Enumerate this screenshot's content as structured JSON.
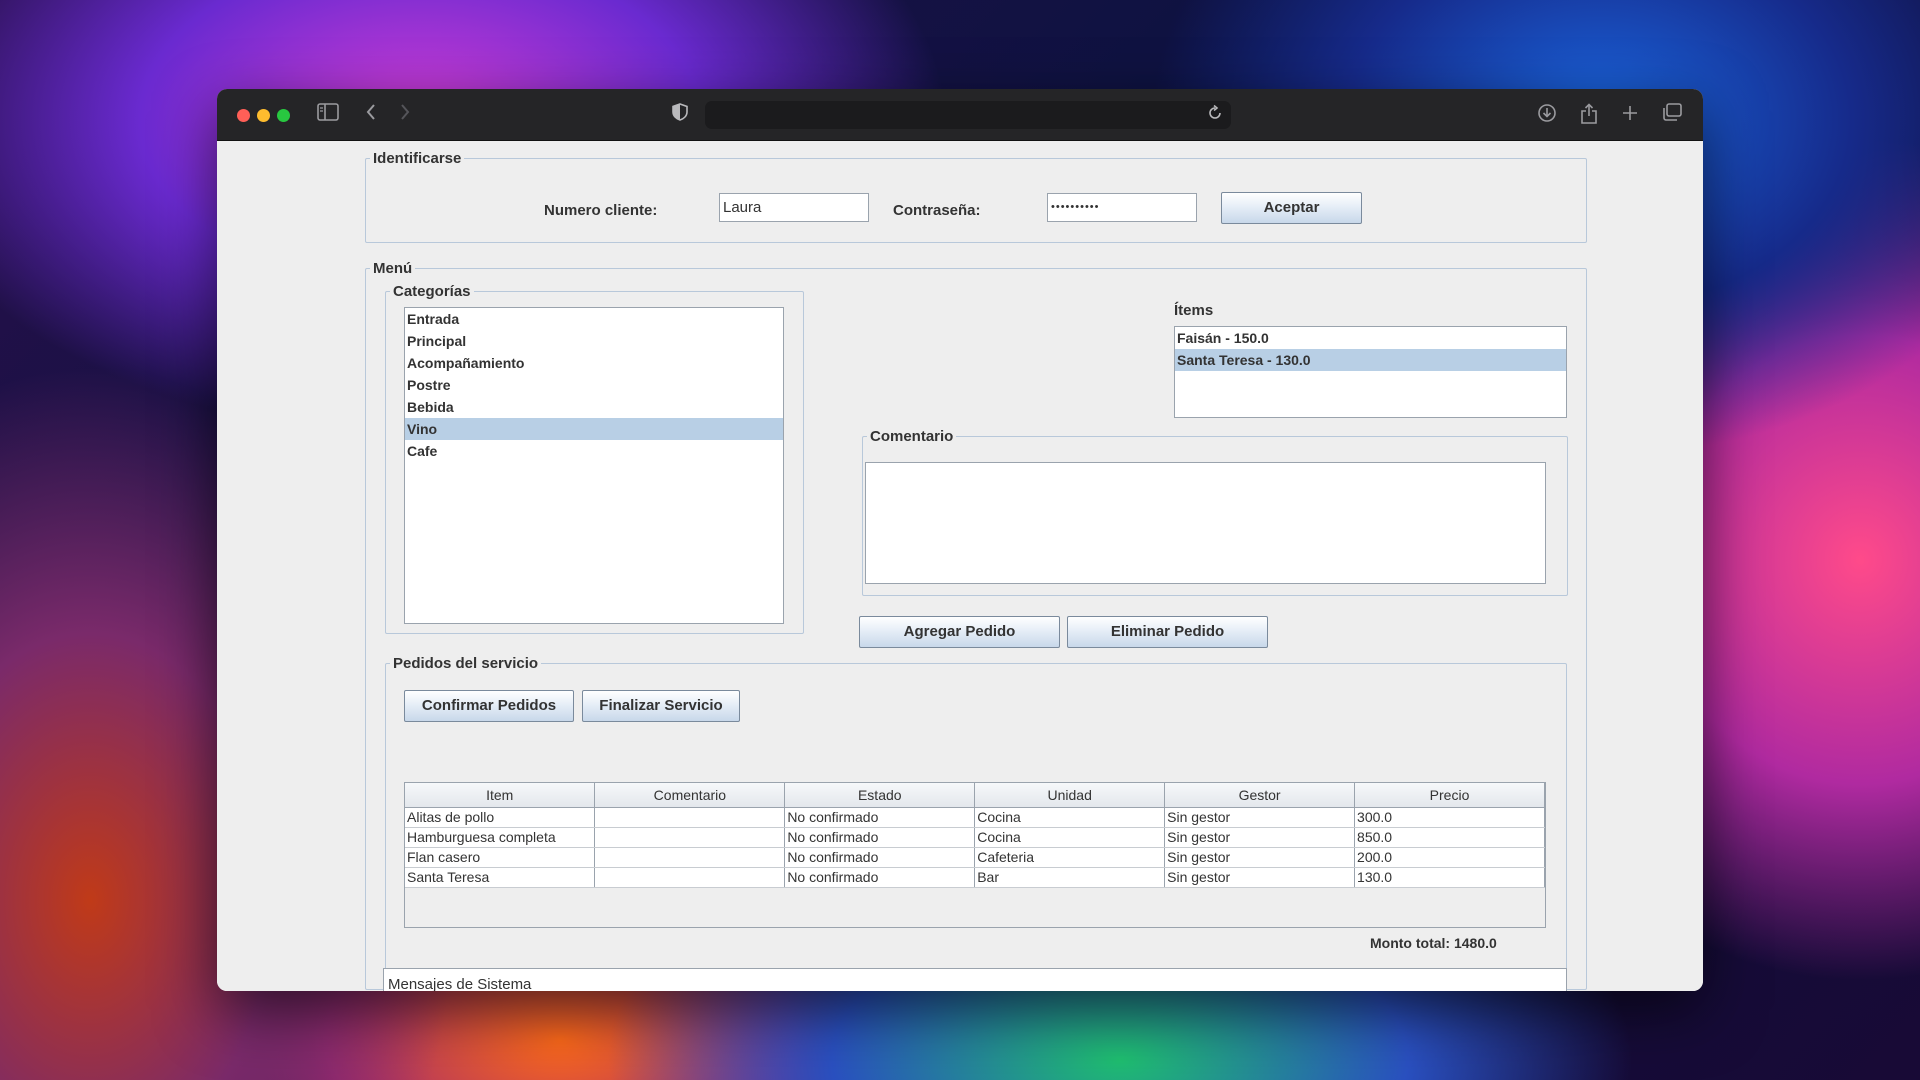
{
  "login": {
    "legend": "Identificarse",
    "client_label": "Numero cliente:",
    "client_value": "Laura",
    "password_label": "Contraseña:",
    "password_value": "••••••••••",
    "accept_label": "Aceptar"
  },
  "menu": {
    "legend": "Menú",
    "categories_legend": "Categorías",
    "categories": [
      "Entrada",
      "Principal",
      "Acompañamiento",
      "Postre",
      "Bebida",
      "Vino",
      "Cafe"
    ],
    "selected_category": "Vino",
    "items_label": "Ítems",
    "items": [
      "Faisán - 150.0",
      "Santa Teresa - 130.0"
    ],
    "selected_item": "Santa Teresa - 130.0",
    "comment_legend": "Comentario",
    "comment_value": "",
    "add_order_label": "Agregar Pedido",
    "remove_order_label": "Eliminar Pedido"
  },
  "orders": {
    "legend": "Pedidos del servicio",
    "confirm_label": "Confirmar Pedidos",
    "finish_label": "Finalizar Servicio",
    "columns": [
      "Item",
      "Comentario",
      "Estado",
      "Unidad",
      "Gestor",
      "Precio"
    ],
    "rows": [
      [
        "Alitas de pollo",
        "",
        "No confirmado",
        "Cocina",
        "Sin gestor",
        "300.0"
      ],
      [
        "Hamburguesa completa",
        "",
        "No confirmado",
        "Cocina",
        "Sin gestor",
        "850.0"
      ],
      [
        "Flan casero",
        "",
        "No confirmado",
        "Cafeteria",
        "Sin gestor",
        "200.0"
      ],
      [
        "Santa Teresa",
        "",
        "No confirmado",
        "Bar",
        "Sin gestor",
        "130.0"
      ]
    ],
    "total_text": "Monto total: 1480.0"
  },
  "system_messages": "Mensajes de Sistema",
  "browser": {
    "icons": [
      "sidebar-icon",
      "back-icon",
      "forward-icon",
      "shield-icon",
      "reload-icon",
      "download-icon",
      "share-icon",
      "new-tab-icon",
      "tabs-overview-icon"
    ]
  }
}
